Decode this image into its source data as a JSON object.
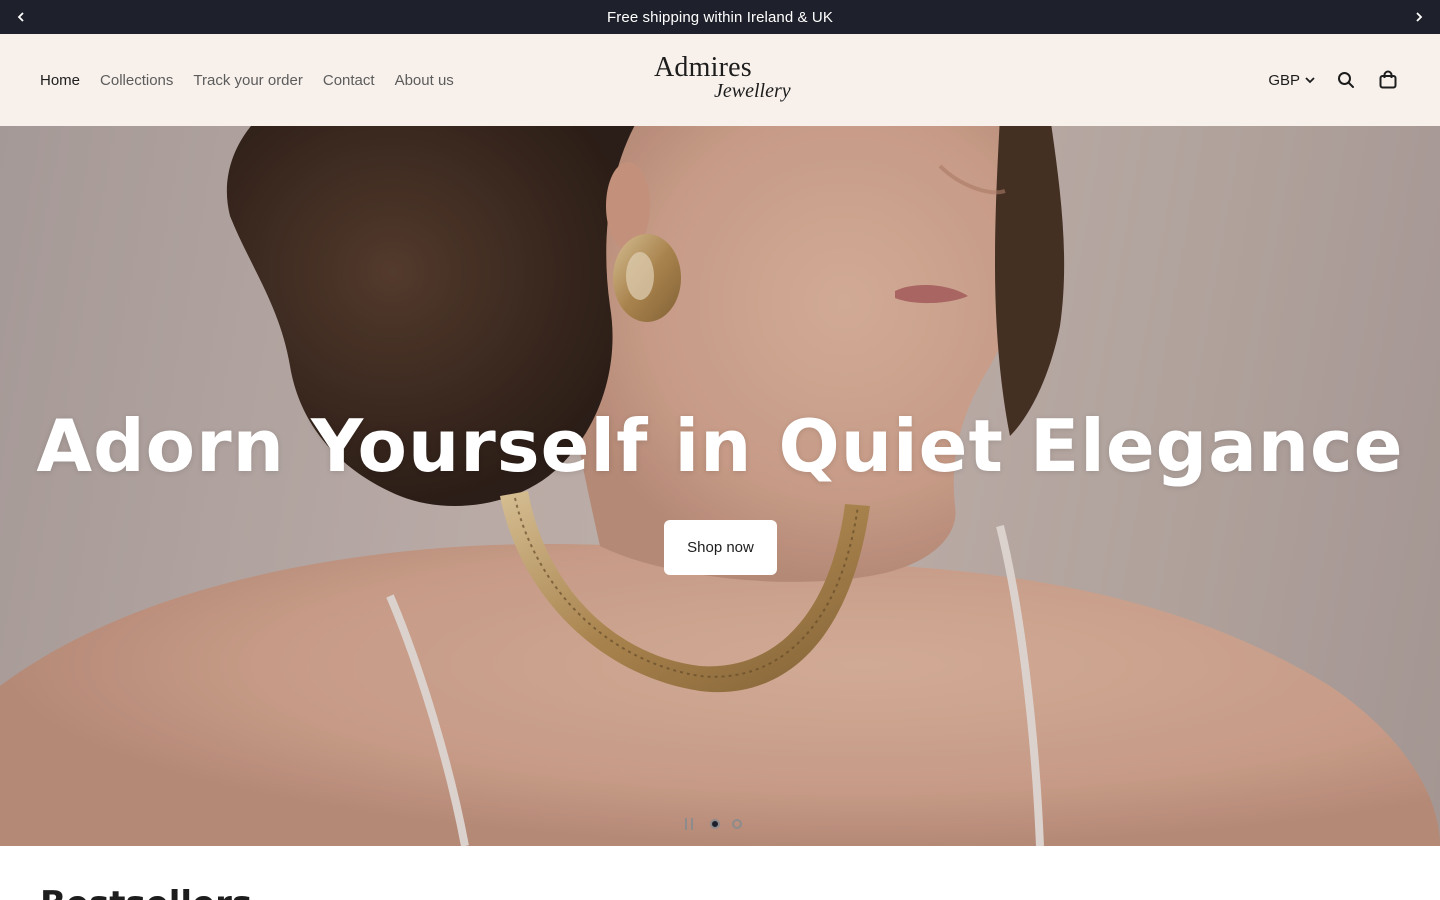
{
  "announcement": {
    "text": "Free shipping within Ireland & UK"
  },
  "header": {
    "nav": [
      {
        "label": "Home",
        "active": true
      },
      {
        "label": "Collections",
        "active": false
      },
      {
        "label": "Track your order",
        "active": false
      },
      {
        "label": "Contact",
        "active": false
      },
      {
        "label": "About us",
        "active": false
      }
    ],
    "logo": {
      "main": "Admires",
      "sub": "Jewellery"
    },
    "currency": "GBP"
  },
  "hero": {
    "title": "Adorn Yourself in Quiet Elegance",
    "button_label": "Shop now",
    "slides_total": 2,
    "slide_active": 1
  },
  "next_section": {
    "heading": "Bestsellers"
  },
  "colors": {
    "announcement_bg": "#1e212b",
    "header_bg": "#f8f1eb",
    "text": "#1d1d1d",
    "nav_muted": "#5c5c5c"
  }
}
